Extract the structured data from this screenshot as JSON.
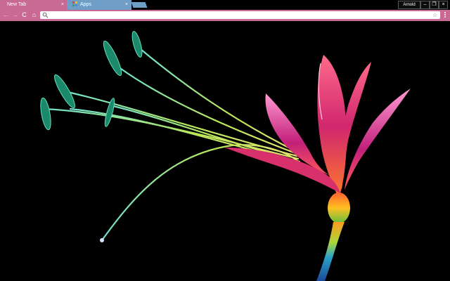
{
  "tabs": [
    {
      "title": "New Tab",
      "close_glyph": "×",
      "active": true,
      "color": "#c86a93"
    },
    {
      "title": "Apps",
      "close_glyph": "×",
      "active": false,
      "color": "#6f9fc6",
      "icon": "apps-grid-icon"
    }
  ],
  "profile": {
    "name": "Arnold"
  },
  "window_controls": {
    "minimize": "–",
    "maximize": "❐",
    "close": "×"
  },
  "toolbar": {
    "back": "←",
    "forward": "→",
    "reload": "C",
    "home": "⌂",
    "bookmark_star": "☆"
  },
  "omnibox": {
    "value": "",
    "placeholder": ""
  },
  "theme": {
    "accent": "#c86a93",
    "inactive_tab": "#6f9fc6",
    "background": "#000000"
  },
  "content": {
    "image": "neon-lily-flower-photo"
  }
}
